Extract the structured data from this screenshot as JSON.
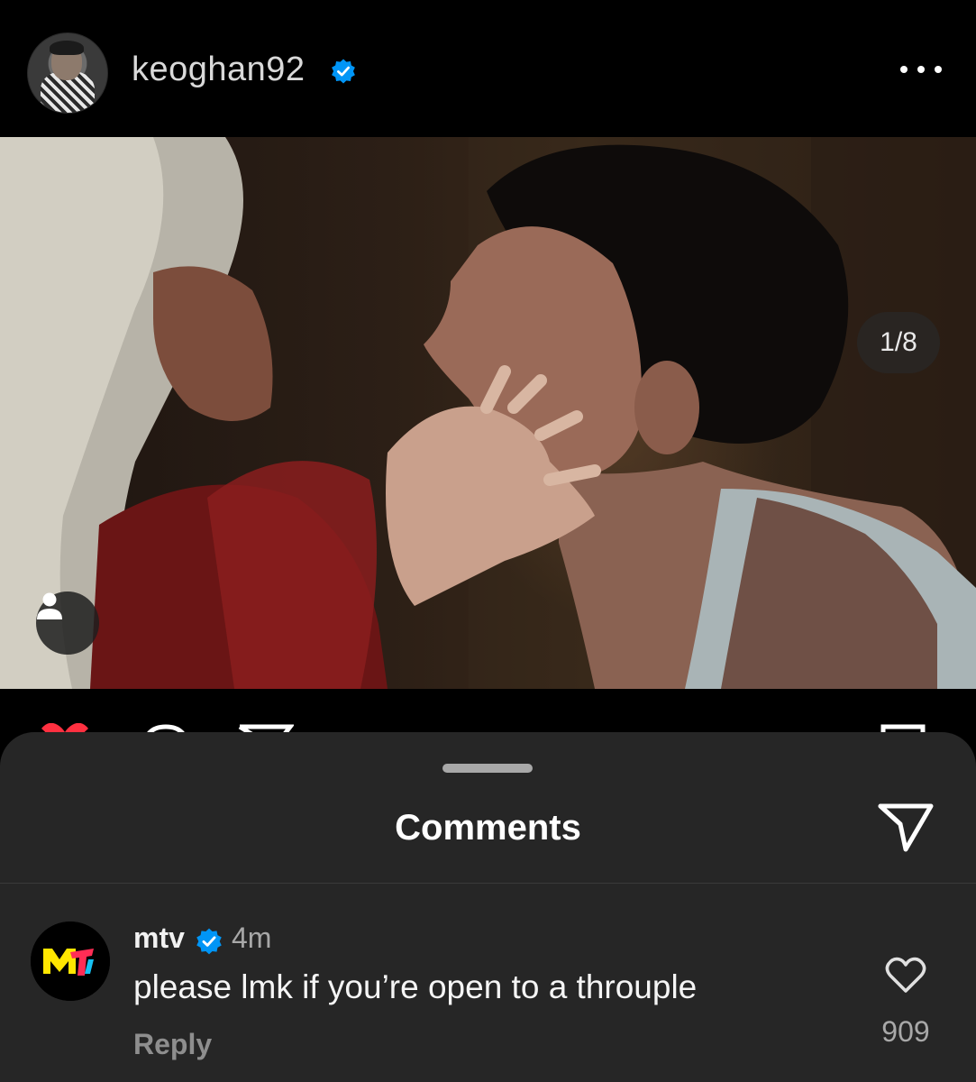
{
  "post": {
    "username": "keoghan92",
    "verified": true,
    "more_icon": "more-horizontal-icon",
    "slide_counter": "1/8",
    "tag_icon": "user-tag-icon"
  },
  "action_bar": {
    "icons": [
      "heart-filled-icon",
      "comment-icon",
      "share-icon",
      "bookmark-icon"
    ],
    "like_color": "#ff3040"
  },
  "comments_sheet": {
    "title": "Comments",
    "share_icon": "send-icon",
    "comments": [
      {
        "username": "mtv",
        "verified": true,
        "time": "4m",
        "text": "please lmk if you’re open to a throuple",
        "reply_label": "Reply",
        "like_count": "909"
      }
    ]
  },
  "colors": {
    "background": "#000000",
    "sheet": "#262626",
    "verified_blue": "#0095f6",
    "secondary_text": "#a8a8a8"
  }
}
